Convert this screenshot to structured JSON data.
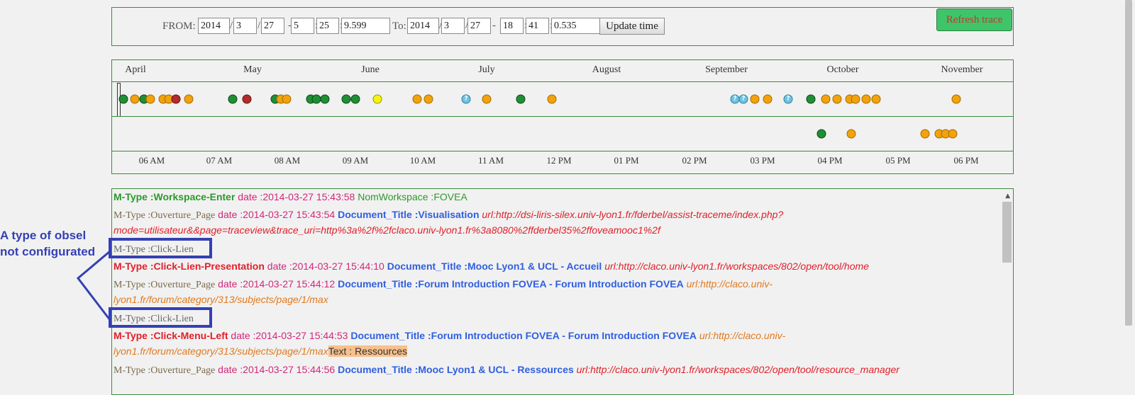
{
  "time_form": {
    "from_label": "FROM:",
    "to_label": "To:",
    "from": {
      "year": "2014",
      "month": "3",
      "day": "27",
      "hour": "5",
      "minute": "25",
      "second": "9.599"
    },
    "to": {
      "year": "2014",
      "month": "3",
      "day": "27",
      "hour": "18",
      "minute": "41",
      "second": "0.535"
    },
    "separators": {
      "date": "/",
      "dash": "-",
      "time": ":"
    },
    "update_label": "Update time",
    "refresh_label": "Refresh trace"
  },
  "timeline": {
    "months": [
      "April",
      "May",
      "June",
      "July",
      "August",
      "September",
      "October",
      "November"
    ],
    "hours": [
      "06 AM",
      "07 AM",
      "08 AM",
      "09 AM",
      "10 AM",
      "11 AM",
      "12 PM",
      "01 PM",
      "02 PM",
      "03 PM",
      "04 PM",
      "05 PM",
      "06 PM"
    ],
    "colors": {
      "orange": "#f2a20c",
      "green": "#1f8f35",
      "red": "#b32b2b",
      "yellow": "#f3f30d",
      "help": "#6fc3e2"
    },
    "help_icon": "?"
  },
  "log": {
    "entries": [
      {
        "mtype": "M-Type :Workspace-Enter",
        "date": "date :2014-03-27 15:43:58",
        "extra": "NomWorkspace :FOVEA"
      },
      {
        "mtype": "M-Type :Ouverture_Page",
        "date": "date :2014-03-27 15:43:54",
        "doc": "Document_Title :Visualisation",
        "url_label": "url",
        "url": ":http://dsi-liris-silex.univ-lyon1.fr/fderbel/assist-traceme/index.php?",
        "url2": "mode=utilisateur&&page=traceview&trace_uri=http%3a%2f%2fclaco.univ-lyon1.fr%3a8080%2ffderbel35%2ffoveamooc1%2f"
      },
      {
        "mtype": "M-Type :Click-Lien"
      },
      {
        "mtype": "M-Type :Click-Lien-Presentation",
        "date": "date :2014-03-27 15:44:10",
        "doc": "Document_Title :Mooc Lyon1 & UCL - Accueil",
        "url_label": "url",
        "url": ":http://claco.univ-lyon1.fr/workspaces/802/open/tool/home"
      },
      {
        "mtype": "M-Type :Ouverture_Page",
        "date": "date :2014-03-27 15:44:12",
        "doc": "Document_Title :Forum Introduction FOVEA - Forum Introduction FOVEA",
        "url_label": "url",
        "url": ":http://claco.univ-",
        "url2": "lyon1.fr/forum/category/313/subjects/page/1/max"
      },
      {
        "mtype": "M-Type :Click-Lien"
      },
      {
        "mtype": "M-Type :Click-Menu-Left",
        "date": "date :2014-03-27 15:44:53",
        "doc": "Document_Title :Forum Introduction FOVEA - Forum Introduction FOVEA",
        "url_label": "url",
        "url": ":http://claco.univ-",
        "url2": "lyon1.fr/forum/category/313/subjects/page/1/max",
        "text": "Text : Ressources"
      },
      {
        "mtype": "M-Type :Ouverture_Page",
        "date": "date :2014-03-27 15:44:56",
        "doc": "Document_Title :Mooc Lyon1 & UCL - Ressources",
        "url_label": "url",
        "url": ":http://claco.univ-lyon1.fr/workspaces/802/open/tool/resource_manager"
      }
    ]
  },
  "annotation": {
    "line1": "A type of obsel",
    "line2": "not configurated",
    "color": "#3440b4"
  }
}
